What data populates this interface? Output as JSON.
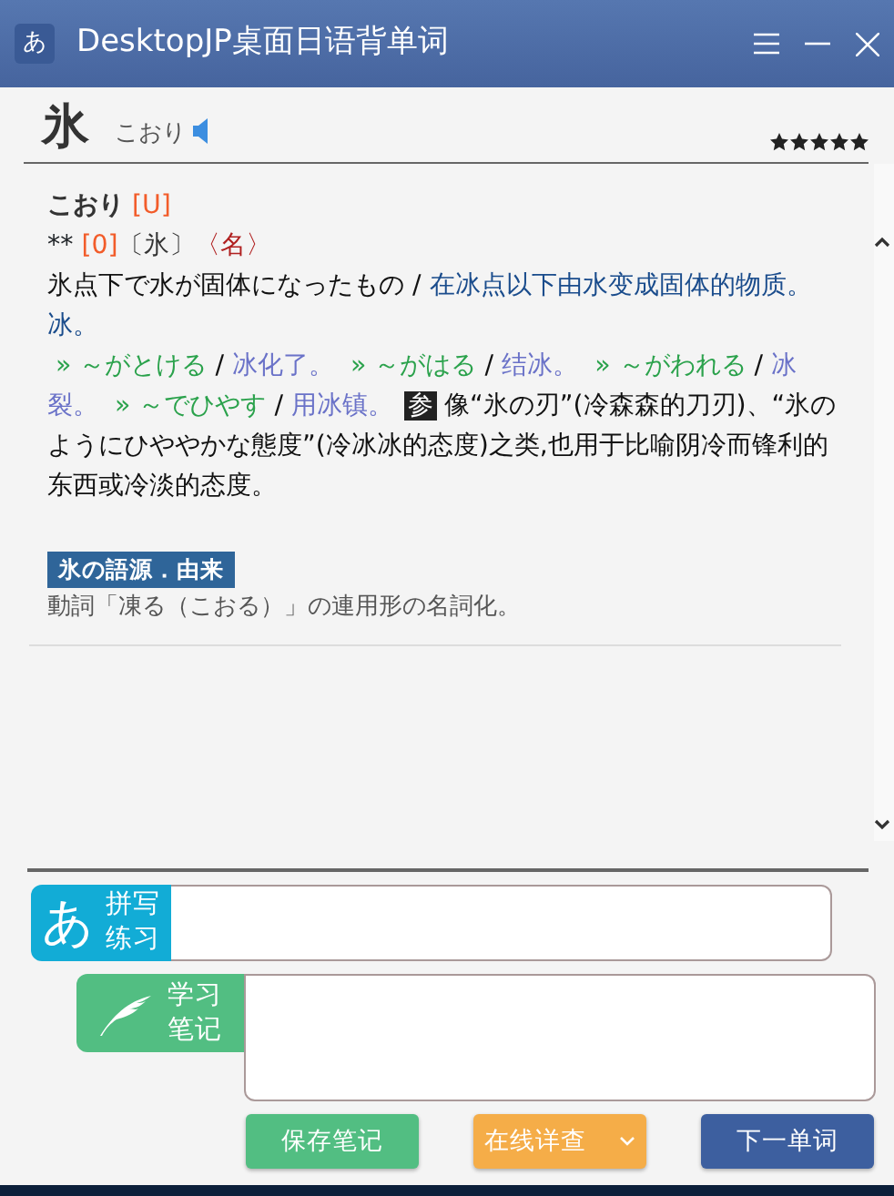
{
  "window": {
    "title": "DesktopJP桌面日语背单词",
    "app_icon": "あ"
  },
  "word": {
    "kanji": "氷",
    "reading": "こおり",
    "stars": 5
  },
  "entry": {
    "heading": "こおり",
    "tag": "[U]",
    "prefix": "**",
    "accent": "[0]",
    "form": "〔氷〕",
    "pos": "〈名〉",
    "definition": [
      {
        "kind": "jp",
        "text": "氷点下で水が固体になったもの"
      },
      {
        "kind": "sep",
        "text": " / "
      },
      {
        "kind": "cn",
        "text": "在冰点以下由水变成固体的物质。冰。"
      }
    ],
    "usage": [
      {
        "kind": "phrase",
        "text": " » ～がとける"
      },
      {
        "kind": "sep",
        "text": " / "
      },
      {
        "kind": "example",
        "text": "冰化了。"
      },
      {
        "kind": "phrase",
        "text": "  » ～がはる"
      },
      {
        "kind": "sep",
        "text": " / "
      },
      {
        "kind": "example",
        "text": "结冰。"
      },
      {
        "kind": "phrase",
        "text": "  » ～がわれる"
      },
      {
        "kind": "sep",
        "text": " / "
      },
      {
        "kind": "example",
        "text": "冰裂。"
      },
      {
        "kind": "phrase",
        "text": "  » ～でひやす"
      },
      {
        "kind": "sep",
        "text": " / "
      },
      {
        "kind": "example",
        "text": "用冰镇。"
      },
      {
        "kind": "ref",
        "text": "参"
      },
      {
        "kind": "plain",
        "text": "像“氷の刃”(冷森森的刀刃)、“氷のようにひややかな態度”(冷冰冰的态度)之类,也用于比喻阴冷而锋利的东西或冷淡的态度。"
      }
    ]
  },
  "etymology": {
    "title": "氷の語源．由来",
    "text": "動詞「凍る（こおる）」の連用形の名詞化。"
  },
  "spelling": {
    "icon_char": "あ",
    "label": [
      "拼写",
      "练习"
    ]
  },
  "notes": {
    "label": [
      "学习",
      "笔记"
    ]
  },
  "buttons": [
    {
      "kind": "save",
      "label": "保存笔记"
    },
    {
      "kind": "lookup",
      "label": "在线详查",
      "dropdown": true
    },
    {
      "kind": "next",
      "label": "下一单词"
    }
  ]
}
